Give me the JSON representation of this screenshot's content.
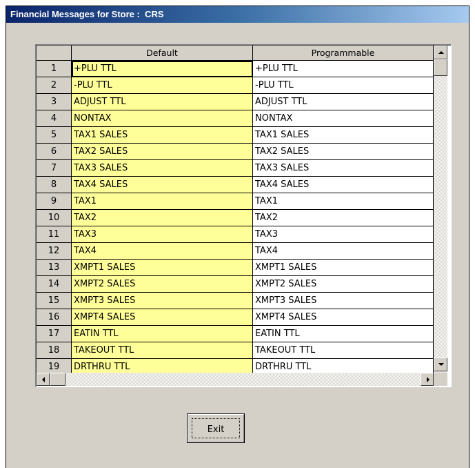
{
  "window": {
    "title": "Financial Messages for Store :  CRS"
  },
  "grid": {
    "columns": {
      "default": "Default",
      "programmable": "Programmable"
    },
    "rows": [
      {
        "num": "1",
        "default": "+PLU TTL",
        "programmable": "+PLU TTL"
      },
      {
        "num": "2",
        "default": "-PLU TTL",
        "programmable": "-PLU TTL"
      },
      {
        "num": "3",
        "default": "ADJUST TTL",
        "programmable": "ADJUST TTL"
      },
      {
        "num": "4",
        "default": "NONTAX",
        "programmable": "NONTAX"
      },
      {
        "num": "5",
        "default": "TAX1 SALES",
        "programmable": "TAX1 SALES"
      },
      {
        "num": "6",
        "default": "TAX2 SALES",
        "programmable": "TAX2 SALES"
      },
      {
        "num": "7",
        "default": "TAX3 SALES",
        "programmable": "TAX3 SALES"
      },
      {
        "num": "8",
        "default": "TAX4 SALES",
        "programmable": "TAX4 SALES"
      },
      {
        "num": "9",
        "default": "TAX1",
        "programmable": "TAX1"
      },
      {
        "num": "10",
        "default": "TAX2",
        "programmable": "TAX2"
      },
      {
        "num": "11",
        "default": "TAX3",
        "programmable": "TAX3"
      },
      {
        "num": "12",
        "default": "TAX4",
        "programmable": "TAX4"
      },
      {
        "num": "13",
        "default": "XMPT1 SALES",
        "programmable": "XMPT1 SALES"
      },
      {
        "num": "14",
        "default": "XMPT2 SALES",
        "programmable": "XMPT2 SALES"
      },
      {
        "num": "15",
        "default": "XMPT3 SALES",
        "programmable": "XMPT3 SALES"
      },
      {
        "num": "16",
        "default": "XMPT4 SALES",
        "programmable": "XMPT4 SALES"
      },
      {
        "num": "17",
        "default": "EATIN TTL",
        "programmable": "EATIN TTL"
      },
      {
        "num": "18",
        "default": "TAKEOUT TTL",
        "programmable": "TAKEOUT TTL"
      },
      {
        "num": "19",
        "default": "DRTHRU TTL",
        "programmable": "DRTHRU TTL"
      }
    ]
  },
  "buttons": {
    "exit": "Exit"
  },
  "icons": {
    "scroll_up": "arrow-up-icon",
    "scroll_down": "arrow-down-icon",
    "scroll_left": "arrow-left-icon",
    "scroll_right": "arrow-right-icon"
  },
  "colors": {
    "default_column_bg": "#ffff99",
    "title_bar": "#0a246a",
    "face": "#d4d0c8"
  }
}
